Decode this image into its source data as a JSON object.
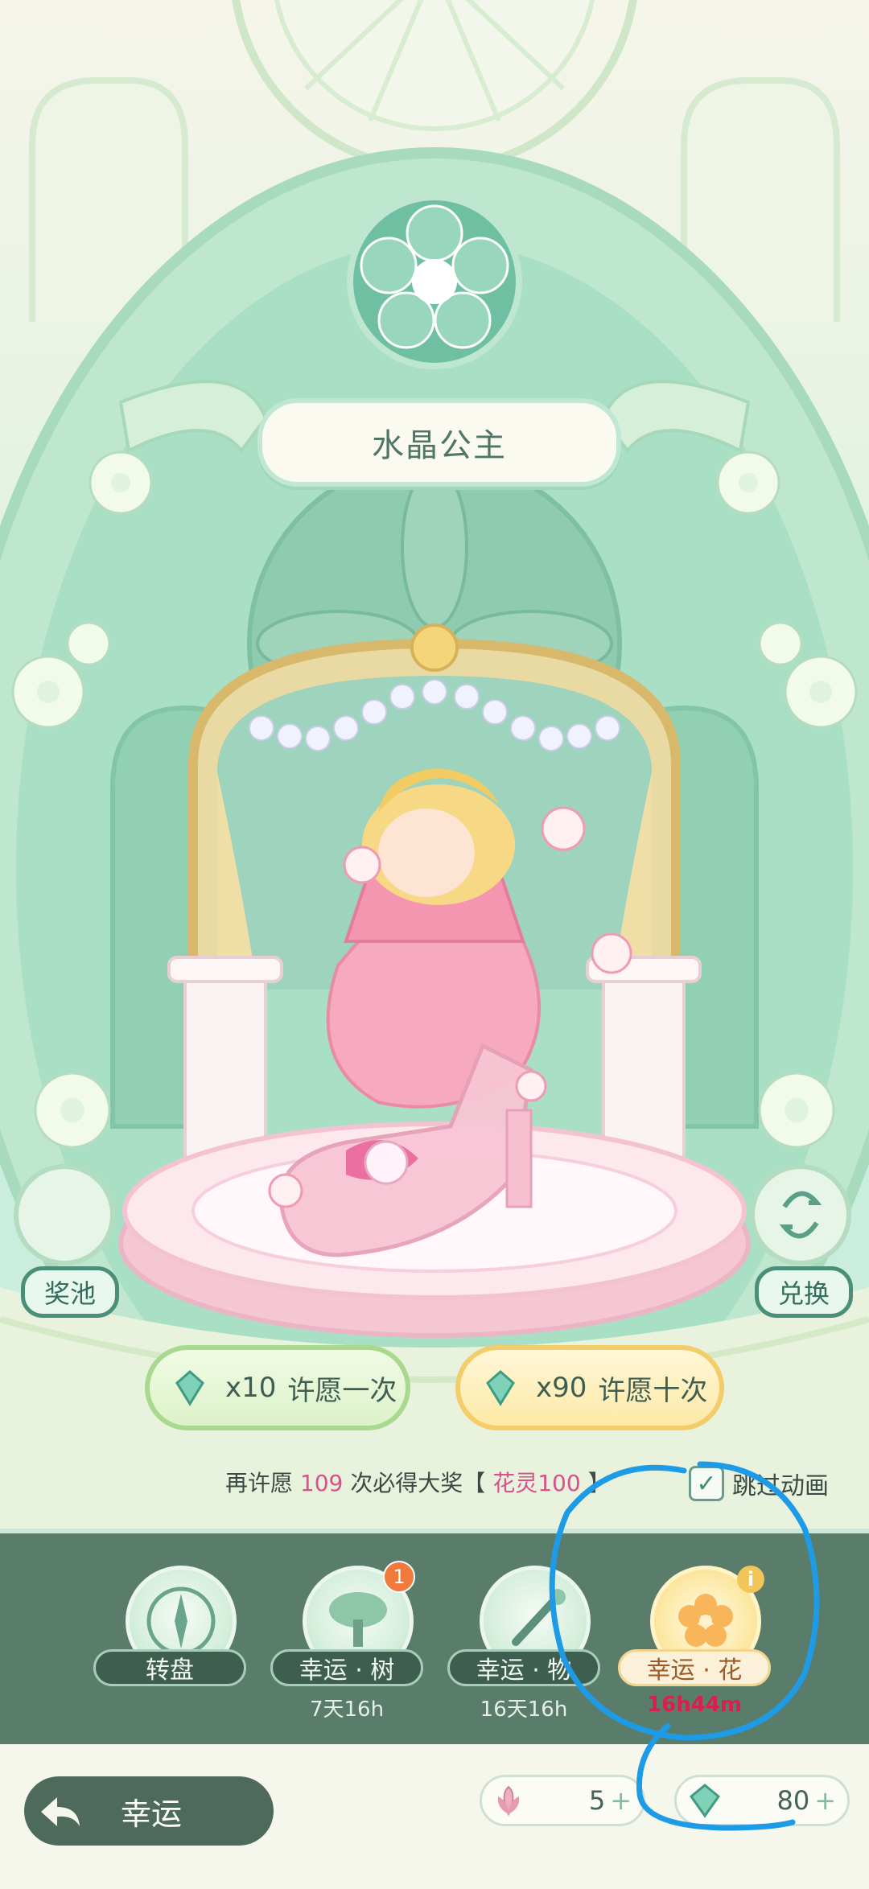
{
  "banner": {
    "title": "水晶公主"
  },
  "side": {
    "pool_label": "奖池",
    "exchange_label": "兑换"
  },
  "wish": {
    "single": {
      "cost": "x10",
      "label": "许愿一次"
    },
    "ten": {
      "cost": "x90",
      "label": "许愿十次"
    }
  },
  "pity": {
    "prefix": "再许愿",
    "count": "109",
    "middle": "次必得大奖【",
    "reward": "花灵100",
    "suffix": "】"
  },
  "skip": {
    "label": "跳过动画",
    "checked": true
  },
  "tabs": [
    {
      "label": "转盘",
      "timer": ""
    },
    {
      "label": "幸运 · 树",
      "timer": "7天16h",
      "badge": "1"
    },
    {
      "label": "幸运 · 物",
      "timer": "16天16h"
    },
    {
      "label": "幸运 · 花",
      "timer": "16h44m",
      "active": true
    }
  ],
  "bottom": {
    "title": "幸运",
    "currency_flower": "5",
    "currency_gem": "80"
  },
  "colors": {
    "accent_green": "#5a7d6b",
    "highlight_pink": "#d9508b",
    "annotation_blue": "#1e9be6"
  }
}
